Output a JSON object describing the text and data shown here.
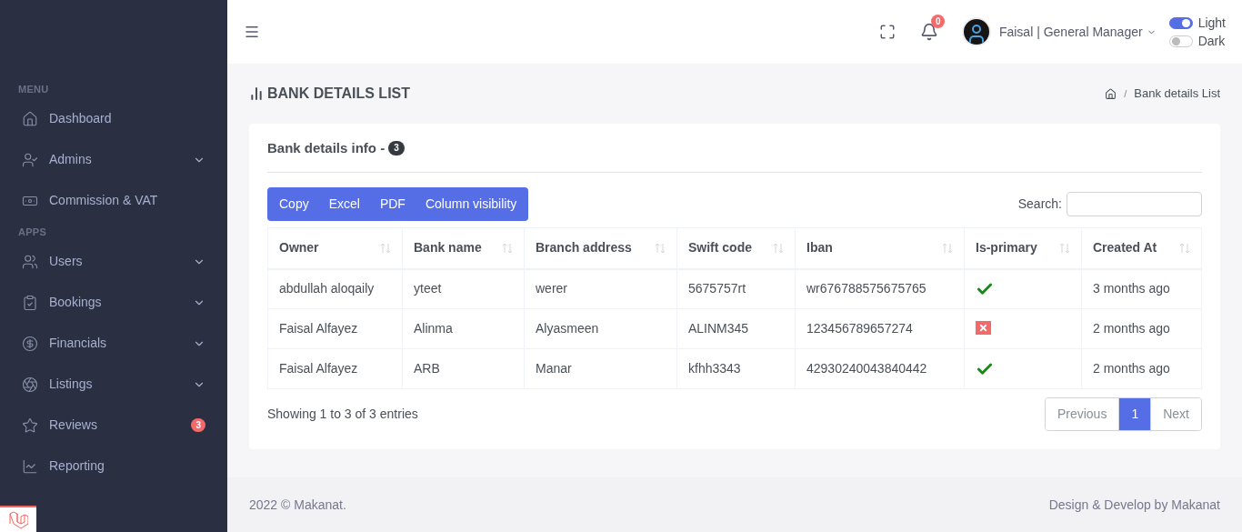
{
  "sidebar": {
    "sections": [
      {
        "title": "MENU",
        "items": [
          {
            "label": "Dashboard",
            "expandable": false
          },
          {
            "label": "Admins",
            "expandable": true
          },
          {
            "label": "Commission & VAT",
            "expandable": false
          }
        ]
      },
      {
        "title": "APPS",
        "items": [
          {
            "label": "Users",
            "expandable": true
          },
          {
            "label": "Bookings",
            "expandable": true
          },
          {
            "label": "Financials",
            "expandable": true
          },
          {
            "label": "Listings",
            "expandable": true
          },
          {
            "label": "Reviews",
            "expandable": false,
            "badge": "3"
          },
          {
            "label": "Reporting",
            "expandable": false
          }
        ]
      }
    ]
  },
  "header": {
    "notifications": "0",
    "user": "Faisal | General Manager",
    "themes": [
      {
        "label": "Light",
        "on": true
      },
      {
        "label": "Dark",
        "on": false
      }
    ]
  },
  "page": {
    "title": "BANK DETAILS LIST",
    "separator": "/",
    "breadcrumb": "Bank details List"
  },
  "card": {
    "title": "Bank details info -",
    "count": "3",
    "buttons": [
      "Copy",
      "Excel",
      "PDF",
      "Column visibility"
    ],
    "search": {
      "label": "Search:"
    },
    "table": {
      "columns": [
        "Owner",
        "Bank name",
        "Branch address",
        "Swift code",
        "Iban",
        "Is-primary",
        "Created At"
      ],
      "rows": [
        {
          "owner": "abdullah aloqaily",
          "bank": "yteet",
          "branch": "werer",
          "swift": "5675757rt",
          "iban": "wr676788575675765",
          "primary": true,
          "created": "3 months ago"
        },
        {
          "owner": "Faisal Alfayez",
          "bank": "Alinma",
          "branch": "Alyasmeen",
          "swift": "ALINM345",
          "iban": "123456789657274",
          "primary": false,
          "created": "2 months ago"
        },
        {
          "owner": "Faisal Alfayez",
          "bank": "ARB",
          "branch": "Manar",
          "swift": "kfhh3343",
          "iban": "42930240043840442",
          "primary": true,
          "created": "2 months ago"
        }
      ]
    },
    "info": "Showing 1 to 3 of 3 entries",
    "pagination": [
      {
        "label": "Previous",
        "disabled": true,
        "selected": false
      },
      {
        "label": "1",
        "disabled": false,
        "selected": true
      },
      {
        "label": "Next",
        "disabled": true,
        "selected": false
      }
    ]
  },
  "footer": {
    "left": "2022 © Makanat.",
    "right": "Design & Develop by Makanat"
  }
}
